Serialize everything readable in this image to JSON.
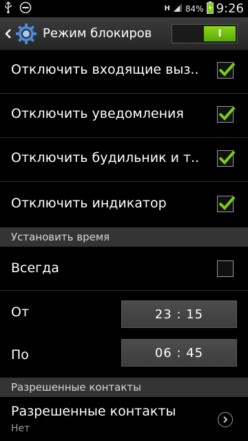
{
  "statusbar": {
    "network": "H",
    "battery_percent": "84%",
    "time": "9:26",
    "icons": [
      "usb-icon",
      "do-not-disturb-icon",
      "signal-icon",
      "battery-icon"
    ]
  },
  "actionbar": {
    "title": "Режим блокиров..",
    "toggle_label": "I",
    "toggle_on": true
  },
  "options": [
    {
      "label": "Отключить входящие выз..",
      "checked": true
    },
    {
      "label": "Отключить уведомления",
      "checked": true
    },
    {
      "label": "Отключить будильник и т..",
      "checked": true
    },
    {
      "label": "Отключить индикатор",
      "checked": true
    }
  ],
  "time_section": {
    "header": "Установить время",
    "always_label": "Всегда",
    "always_checked": false,
    "from_label": "От",
    "from_value": "23 : 15",
    "to_label": "По",
    "to_value": "06 : 45"
  },
  "contacts_section": {
    "header": "Разрешенные контакты",
    "item_label": "Разрешенные контакты",
    "item_sub": "Нет"
  },
  "colors": {
    "accent_green": "#7ccc16",
    "section_bg": "#343434"
  }
}
